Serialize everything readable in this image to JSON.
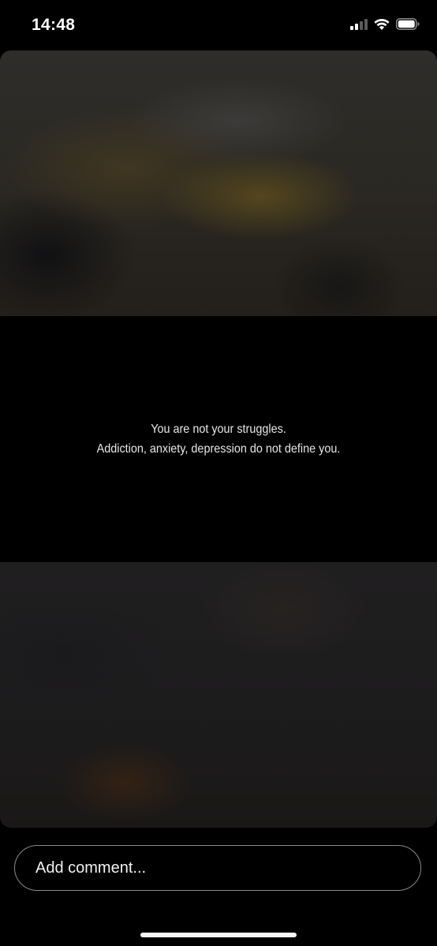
{
  "status_bar": {
    "time": "14:48",
    "icons": [
      "cellular-signal-icon",
      "wifi-icon",
      "battery-icon"
    ]
  },
  "story": {
    "quote_line_1": "You are not your struggles.",
    "quote_line_2": "Addiction, anxiety, depression do not define you."
  },
  "comment": {
    "placeholder": "Add comment..."
  },
  "colors": {
    "background": "#000000",
    "text": "#ffffff",
    "field_border": "#8a8a8a"
  }
}
